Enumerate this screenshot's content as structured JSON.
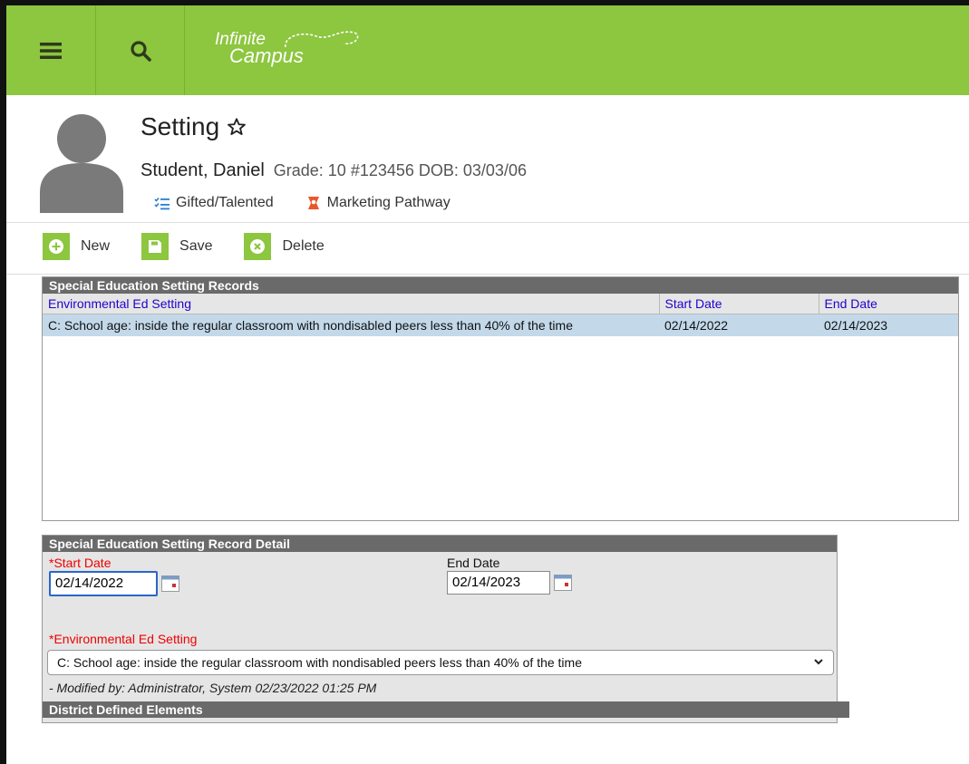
{
  "app": {
    "logo_line1": "Infinite",
    "logo_line2": "Campus",
    "brand_color": "#8dc63f"
  },
  "header": {
    "page_title": "Setting",
    "student_name": "Student, Daniel",
    "student_meta": "Grade: 10 #123456 DOB: 03/03/06",
    "flags": [
      {
        "label": "Gifted/Talented",
        "icon": "list-check-icon"
      },
      {
        "label": "Marketing Pathway",
        "icon": "pathway-icon"
      }
    ]
  },
  "toolbar": {
    "new_label": "New",
    "save_label": "Save",
    "delete_label": "Delete"
  },
  "records": {
    "title": "Special Education Setting Records",
    "columns": [
      "Environmental Ed Setting",
      "Start Date",
      "End Date"
    ],
    "rows": [
      {
        "setting": "C: School age: inside the regular classroom with nondisabled peers less than 40% of the time",
        "start": "02/14/2022",
        "end": "02/14/2023"
      }
    ]
  },
  "detail": {
    "title": "Special Education Setting Record Detail",
    "start_label": "*Start Date",
    "start_value": "02/14/2022",
    "end_label": "End Date",
    "end_value": "02/14/2023",
    "setting_label": "*Environmental Ed Setting",
    "setting_value": "C: School age: inside the regular classroom with nondisabled peers less than 40% of the time",
    "modified": "- Modified by: Administrator, System 02/23/2022 01:25 PM",
    "district_title": "District Defined Elements"
  }
}
